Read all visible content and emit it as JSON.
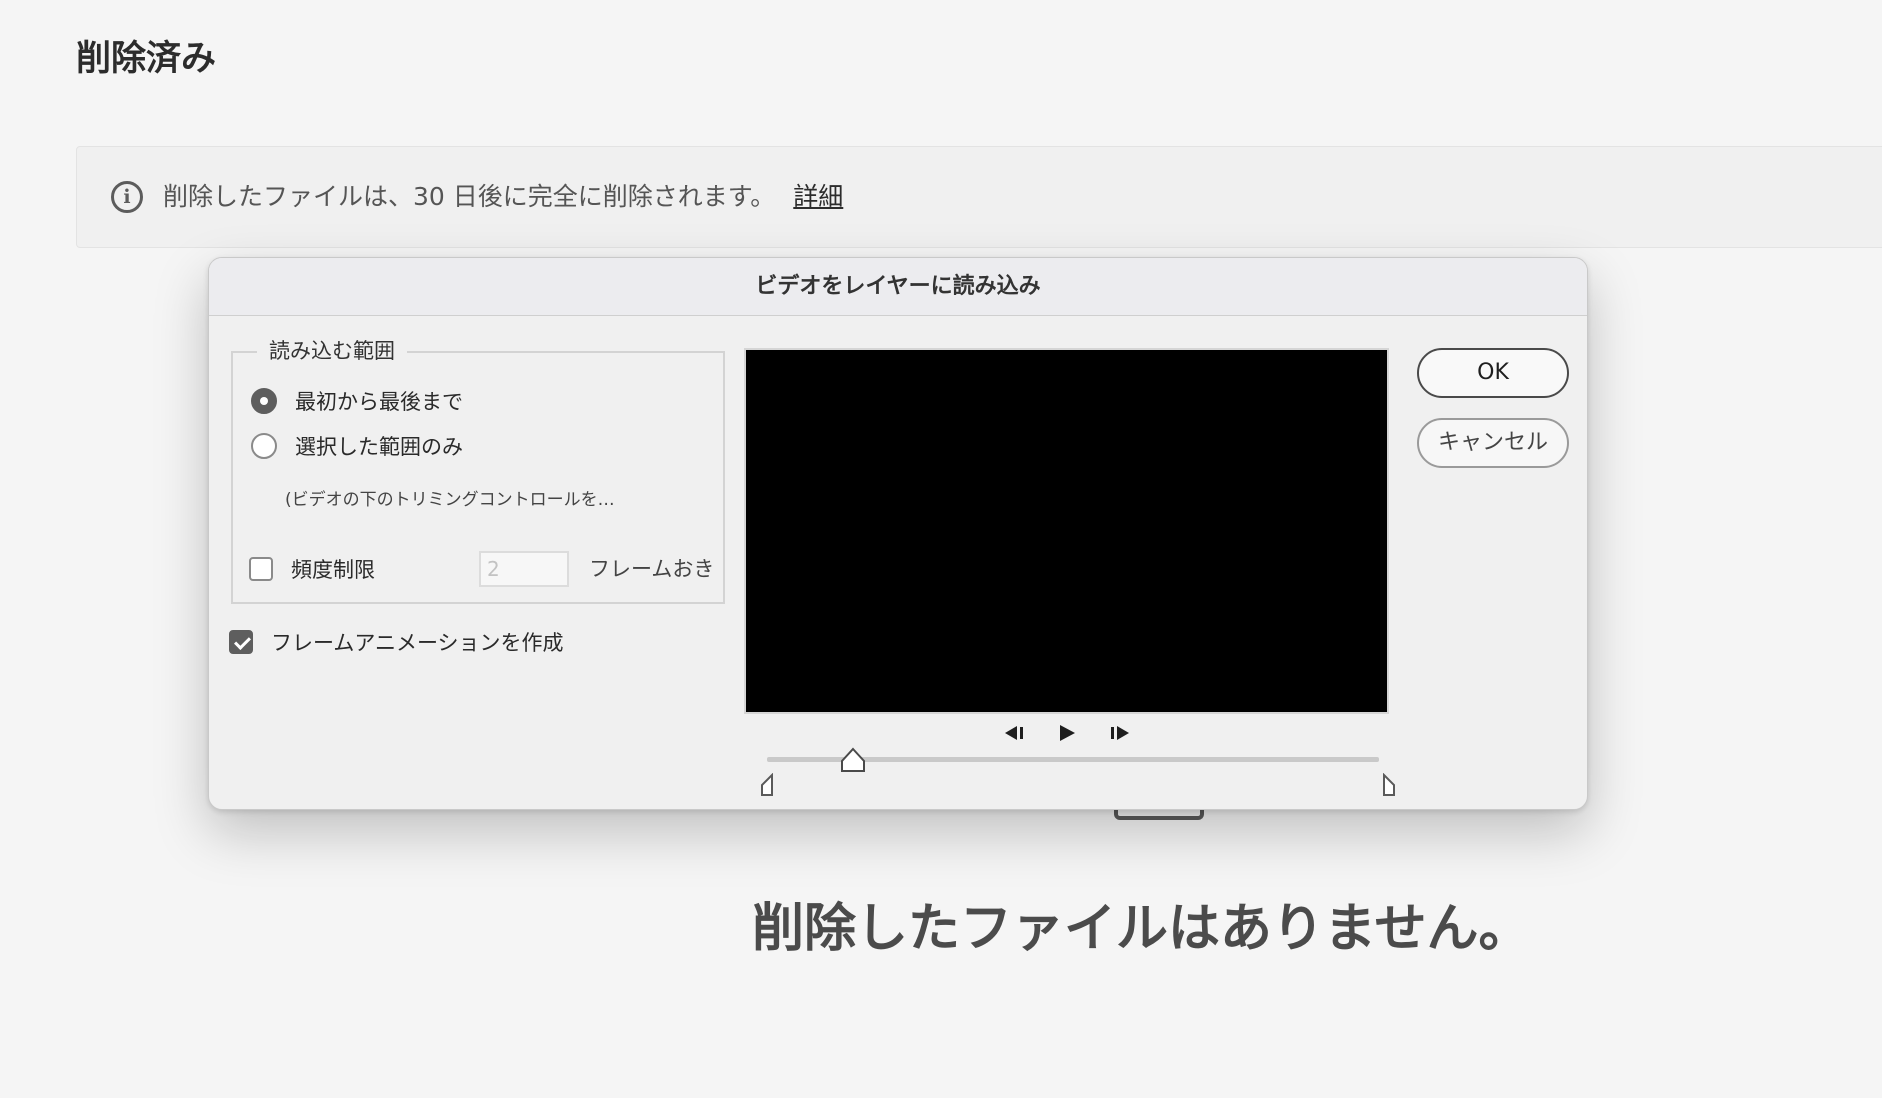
{
  "page": {
    "title": "削除済み",
    "info_banner": {
      "icon": "info-icon",
      "message": "削除したファイルは、30 日後に完全に削除されます。",
      "link_label": "詳細"
    },
    "empty_message": "削除したファイルはありません。"
  },
  "dialog": {
    "title": "ビデオをレイヤーに読み込み",
    "range_group": {
      "legend": "読み込む範囲",
      "options": [
        {
          "label": "最初から最後まで",
          "selected": true
        },
        {
          "label": "選択した範囲のみ",
          "selected": false
        }
      ],
      "hint": "(ビデオの下のトリミングコントロールを…",
      "frequency": {
        "label": "頻度制限",
        "checked": false,
        "value": "2",
        "suffix": "フレームおき"
      }
    },
    "frame_animation": {
      "label": "フレームアニメーションを作成",
      "checked": true
    },
    "preview": {
      "controls": [
        "step-back-icon",
        "play-icon",
        "step-forward-icon"
      ],
      "playhead_fraction": 0.14
    },
    "buttons": {
      "ok_label": "OK",
      "cancel_label": "キャンセル"
    }
  }
}
